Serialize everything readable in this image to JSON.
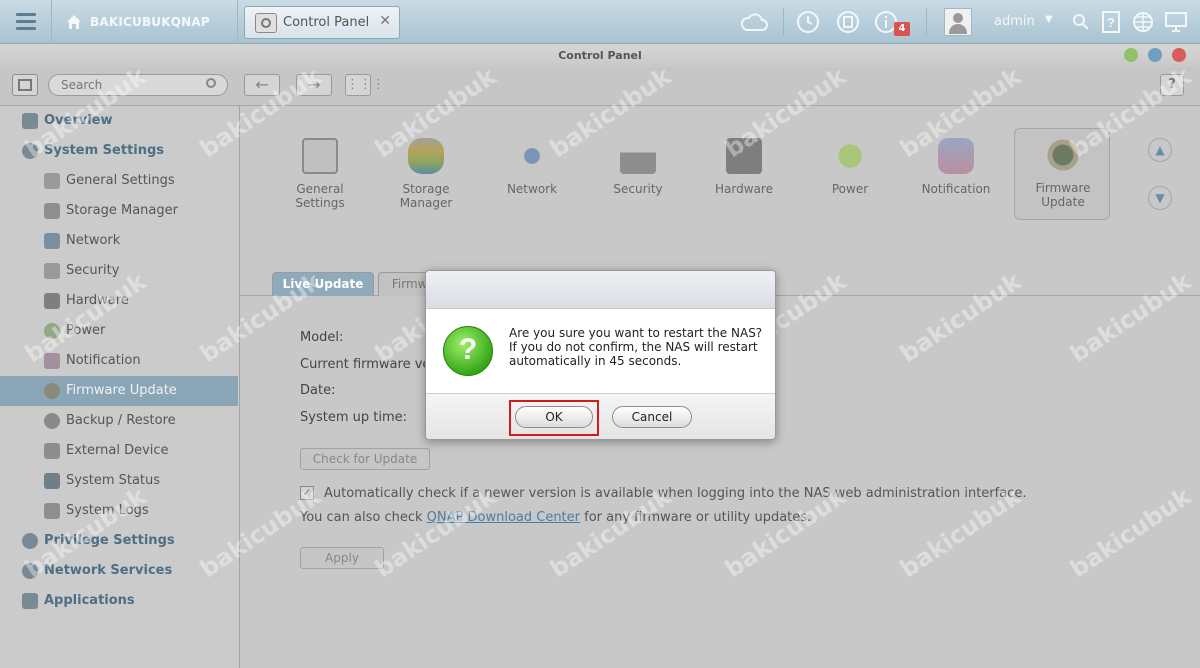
{
  "topbar": {
    "host": "BAKICUBUKQNAP",
    "tab_label": "Control Panel",
    "notification_count": "4",
    "user": "admin"
  },
  "window": {
    "title": "Control Panel",
    "search_placeholder": "Search",
    "help": "?"
  },
  "sidebar": {
    "overview": "Overview",
    "system_settings": "System Settings",
    "items": [
      "General Settings",
      "Storage Manager",
      "Network",
      "Security",
      "Hardware",
      "Power",
      "Notification",
      "Firmware Update",
      "Backup / Restore",
      "External Device",
      "System Status",
      "System Logs"
    ],
    "privilege_settings": "Privilege Settings",
    "network_services": "Network Services",
    "applications": "Applications"
  },
  "categories": [
    {
      "line1": "General",
      "line2": "Settings"
    },
    {
      "line1": "Storage",
      "line2": "Manager"
    },
    {
      "line1": "Network",
      "line2": ""
    },
    {
      "line1": "Security",
      "line2": ""
    },
    {
      "line1": "Hardware",
      "line2": ""
    },
    {
      "line1": "Power",
      "line2": ""
    },
    {
      "line1": "Notification",
      "line2": ""
    },
    {
      "line1": "Firmware",
      "line2": "Update"
    }
  ],
  "subtabs": {
    "live_update": "Live Update",
    "firmware_update": "Firmware Update"
  },
  "content": {
    "model": "Model:",
    "current_firmware": "Current firmware ver",
    "date": "Date:",
    "uptime": "System up time:",
    "check_button": "Check for Update",
    "auto_check": "Automatically check if a newer version is available when logging into the NAS web administration interface.",
    "also_check_prefix": "You can also check",
    "also_check_link": "QNAP Download Center",
    "also_check_suffix": "for any firmware or utility updates.",
    "apply": "Apply"
  },
  "dialog": {
    "message": "Are you sure you want to restart the NAS? If you do not confirm, the NAS will restart automatically in 45 seconds.",
    "ok": "OK",
    "cancel": "Cancel"
  },
  "watermark": "bakicubuk",
  "colors": {
    "accent": "#4d6f85",
    "selected_row": "#8aa5b6",
    "ok_highlight": "#d01c1c",
    "dialog_icon": "#37a818"
  }
}
